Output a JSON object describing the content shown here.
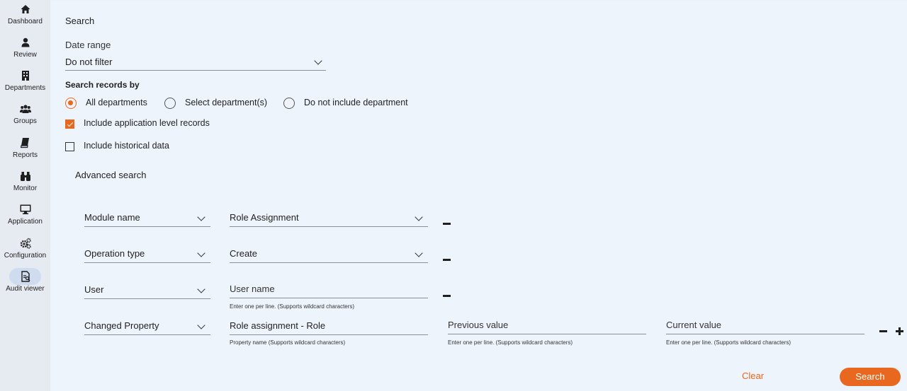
{
  "sidebar": {
    "items": [
      {
        "label": "Dashboard",
        "icon": "home-icon"
      },
      {
        "label": "Review",
        "icon": "person-icon"
      },
      {
        "label": "Departments",
        "icon": "building-icon"
      },
      {
        "label": "Groups",
        "icon": "group-icon"
      },
      {
        "label": "Reports",
        "icon": "book-icon"
      },
      {
        "label": "Monitor",
        "icon": "binoculars-icon"
      },
      {
        "label": "Application",
        "icon": "monitor-icon"
      },
      {
        "label": "Configuration",
        "icon": "gears-icon"
      },
      {
        "label": "Audit viewer",
        "icon": "audit-icon",
        "active": true
      }
    ]
  },
  "search": {
    "title": "Search",
    "date_range": {
      "label": "Date range",
      "value": "Do not filter"
    },
    "records_by": {
      "label": "Search records by",
      "options": [
        "All departments",
        "Select department(s)",
        "Do not include department"
      ],
      "selected": "All departments"
    },
    "checkboxes": [
      {
        "label": "Include application level records",
        "checked": true
      },
      {
        "label": "Include historical data",
        "checked": false
      }
    ]
  },
  "advanced": {
    "title": "Advanced search",
    "rows": [
      {
        "field": "Module name",
        "value": "Role Assignment"
      },
      {
        "field": "Operation type",
        "value": "Create"
      },
      {
        "field": "User",
        "input_placeholder": "User name",
        "hint": "Enter one per line. (Supports wildcard characters)"
      },
      {
        "field": "Changed Property",
        "property_value": "Role assignment - Role",
        "property_hint": "Property name (Supports wildcard characters)",
        "previous_placeholder": "Previous value",
        "previous_hint": "Enter one per line. (Supports wildcard characters)",
        "current_placeholder": "Current value",
        "current_hint": "Enter one per line. (Supports wildcard characters)"
      }
    ]
  },
  "actions": {
    "clear": "Clear",
    "search": "Search"
  },
  "colors": {
    "accent": "#e8681f",
    "background": "#eef4fc",
    "sidebar": "#e6ebf2"
  }
}
